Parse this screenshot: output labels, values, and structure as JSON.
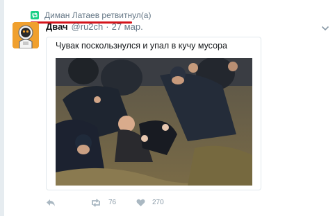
{
  "retweet": {
    "text": "Диман Латаев ретвитнул(а)",
    "badge_color": "#19cf86",
    "underline_color": "#d4131a"
  },
  "tweet": {
    "author_name": "Двач",
    "handle": "@ru2ch",
    "separator": "·",
    "date": "27 мар.",
    "text": "Чувак поскользнулся и упал в кучу мусора",
    "avatar_icon": "astronaut-avatar",
    "menu_icon": "chevron-down-icon"
  },
  "actions": {
    "reply_icon": "reply-icon",
    "retweet_icon": "retweet-icon",
    "retweet_count": "76",
    "like_icon": "heart-icon",
    "like_count": "270"
  }
}
